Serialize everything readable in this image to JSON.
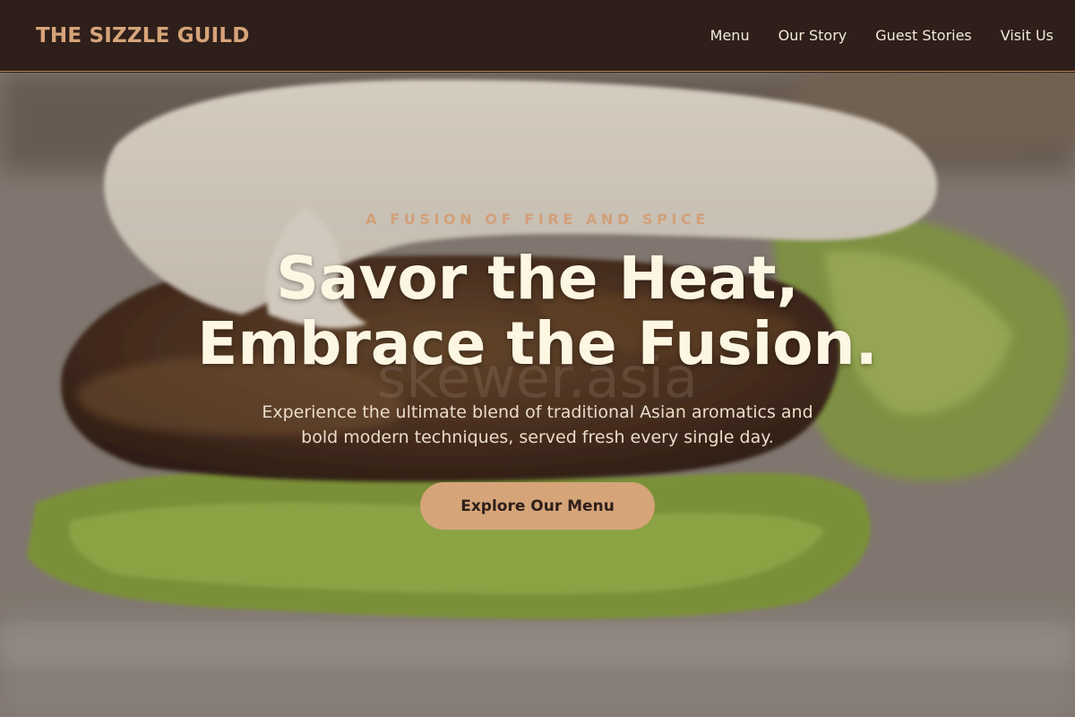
{
  "header": {
    "brand": "THE SIZZLE GUILD",
    "nav": [
      "Menu",
      "Our Story",
      "Guest Stories",
      "Visit Us"
    ]
  },
  "hero": {
    "background_image": "skewered grilled fusion dish on lettuce",
    "watermark": "skewer.asia",
    "eyebrow": "A FUSION OF FIRE AND SPICE",
    "headline_line1": "Savor the Heat,",
    "headline_line2": "Embrace the Fusion.",
    "subhead_line1": "Experience the ultimate blend of traditional Asian aromatics and",
    "subhead_line2": "bold modern techniques, served fresh every single day.",
    "cta_label": "Explore Our Menu"
  },
  "colors": {
    "header_bg": "#2e1f1a",
    "accent": "#d6a479",
    "headline": "#fdf6e3"
  }
}
